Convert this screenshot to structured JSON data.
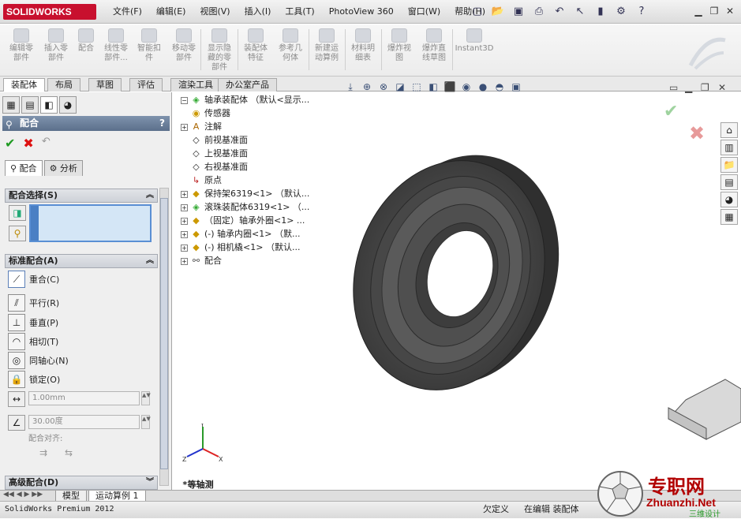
{
  "app": {
    "logo_text": "SOLIDWORKS"
  },
  "menu": [
    "文件(F)",
    "编辑(E)",
    "视图(V)",
    "插入(I)",
    "工具(T)",
    "PhotoView 360",
    "窗口(W)",
    "帮助(H)"
  ],
  "commands": [
    {
      "label": "编辑零\n部件"
    },
    {
      "label": "插入零\n部件"
    },
    {
      "label": "配合"
    },
    {
      "label": "线性零\n部件..."
    },
    {
      "label": "智能扣\n件"
    },
    {
      "label": "移动零\n部件"
    },
    {
      "label": "显示隐\n藏的零\n部件"
    },
    {
      "label": "装配体\n特征"
    },
    {
      "label": "参考几\n何体"
    },
    {
      "label": "新建运\n动算例"
    },
    {
      "label": "材料明\n细表"
    },
    {
      "label": "爆炸视\n图"
    },
    {
      "label": "爆炸直\n线草图"
    },
    {
      "label": "Instant3D"
    }
  ],
  "command_tabs": [
    "装配体",
    "布局",
    "草图",
    "评估",
    "渲染工具",
    "办公室产品"
  ],
  "property_manager": {
    "title": "配合",
    "help": "?",
    "subtabs": [
      "配合",
      "分析"
    ],
    "group_selection": "配合选择(S)",
    "group_standard": "标准配合(A)",
    "group_advanced": "高级配合(D)",
    "mates": [
      {
        "label": "重合(C)",
        "icon": "coincident-icon"
      },
      {
        "label": "平行(R)",
        "icon": "parallel-icon"
      },
      {
        "label": "垂直(P)",
        "icon": "perpendicular-icon"
      },
      {
        "label": "相切(T)",
        "icon": "tangent-icon"
      },
      {
        "label": "同轴心(N)",
        "icon": "concentric-icon"
      },
      {
        "label": "锁定(O)",
        "icon": "lock-icon"
      }
    ],
    "distance_value": "1.00mm",
    "angle_value": "30.00度",
    "alignment_label": "配合对齐:"
  },
  "tree": {
    "root": "轴承装配体 （默认<显示...",
    "items": [
      {
        "label": "传感器",
        "expand": false
      },
      {
        "label": "注解",
        "expand": true
      },
      {
        "label": "前视基准面",
        "expand": false
      },
      {
        "label": "上视基准面",
        "expand": false
      },
      {
        "label": "右视基准面",
        "expand": false
      },
      {
        "label": "原点",
        "expand": false
      },
      {
        "label": "保持架6319<1> （默认...",
        "expand": true
      },
      {
        "label": "滚珠装配体6319<1> （...",
        "expand": true
      },
      {
        "label": "（固定）轴承外圈<1> ...",
        "expand": true
      },
      {
        "label": "(-) 轴承内圈<1> （默...",
        "expand": true
      },
      {
        "label": "(-) 相机橇<1> （默认...",
        "expand": true
      },
      {
        "label": "配合",
        "expand": true
      }
    ]
  },
  "view_label": "*等轴测",
  "bottom_tabs": [
    "模型",
    "运动算例 1"
  ],
  "status": {
    "left": "SolidWorks Premium 2012",
    "undefined": "欠定义",
    "editing": "在编辑 装配体"
  },
  "watermark": {
    "cn": "专职网",
    "en": "Zhuanzhi.Net",
    "sub": "三维设计"
  }
}
